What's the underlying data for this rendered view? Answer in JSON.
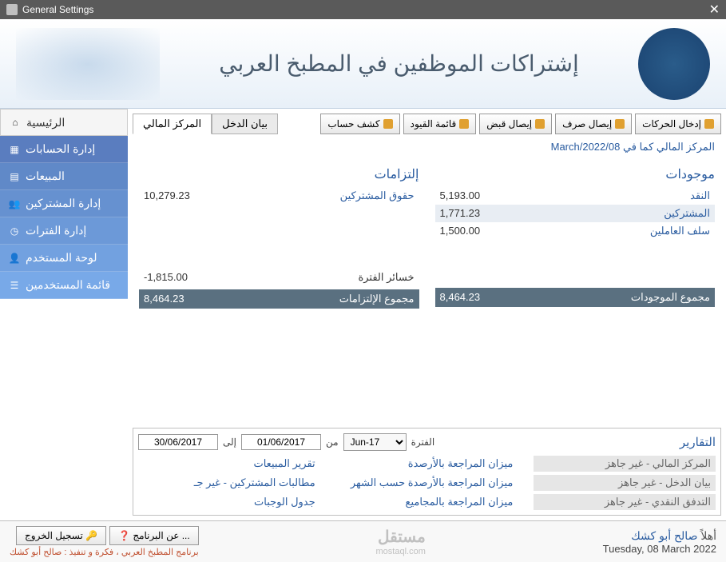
{
  "window": {
    "title": "General Settings"
  },
  "header": {
    "title": "إشتراكات الموظفين في المطبخ العربي"
  },
  "sidebar": {
    "home": "الرئيسية",
    "accounts": "إدارة الحسابات",
    "sales": "المبيعات",
    "subscribers": "إدارة المشتركين",
    "periods": "إدارة الفترات",
    "userpanel": "لوحة المستخدم",
    "users": "قائمة المستخدمين"
  },
  "tabs": {
    "financial": "المركز المالي",
    "income": "بيان الدخل"
  },
  "toolbar": {
    "entries": "إدخال الحركات",
    "pay_voucher": "إيصال صرف",
    "receipt_voucher": "إيصال قبض",
    "journal_list": "قائمة القيود",
    "statement": "كشف حساب"
  },
  "status": {
    "asof_prefix": "المركز المالي كما في",
    "asof_date": "March/2022/08"
  },
  "assets": {
    "title": "موجودات",
    "rows": [
      {
        "label": "النقد",
        "value": "5,193.00"
      },
      {
        "label": "المشتركين",
        "value": "1,771.23"
      },
      {
        "label": "سلف العاملين",
        "value": "1,500.00"
      }
    ],
    "total_label": "مجموع الموجودات",
    "total_value": "8,464.23"
  },
  "liabilities": {
    "title": "إلتزامات",
    "rows": [
      {
        "label": "حقوق المشتركين",
        "value": "10,279.23"
      }
    ],
    "period_loss_label": "خسائر الفترة",
    "period_loss_value": "-1,815.00",
    "total_label": "مجموع الإلتزامات",
    "total_value": "8,464.23"
  },
  "reports": {
    "title": "التقارير",
    "period_label": "الفترة",
    "period_value": "Jun-17",
    "from_label": "من",
    "from_date": "01/06/2017",
    "to_label": "إلى",
    "to_date": "30/06/2017",
    "statuses": {
      "financial": "المركز المالي - غير جاهز",
      "income": "بيان الدخل - غير جاهز",
      "cashflow": "التدفق النقدي - غير جاهز"
    },
    "links": {
      "trial_balances": "ميزان المراجعة بالأرصدة",
      "trial_monthly": "ميزان المراجعة بالأرصدة حسب الشهر",
      "trial_totals": "ميزان المراجعة بالمجاميع",
      "sales_report": "تقرير المبيعات",
      "subscriber_claims": "مطالبات المشتركين - غير جـ",
      "meals_table": "جدول الوجبات"
    }
  },
  "footer": {
    "welcome": "أهلاً",
    "user": "صالح أبو كشك",
    "date": "Tuesday, 08 March 2022",
    "watermark": "مستقل",
    "watermark_sub": "mostaql.com",
    "about": "عن البرنامج ...",
    "logout": "تسجيل الخروج",
    "credits": "برنامج المطبخ العربي ، فكرة و تنفيذ : صالح أبو كشك"
  }
}
